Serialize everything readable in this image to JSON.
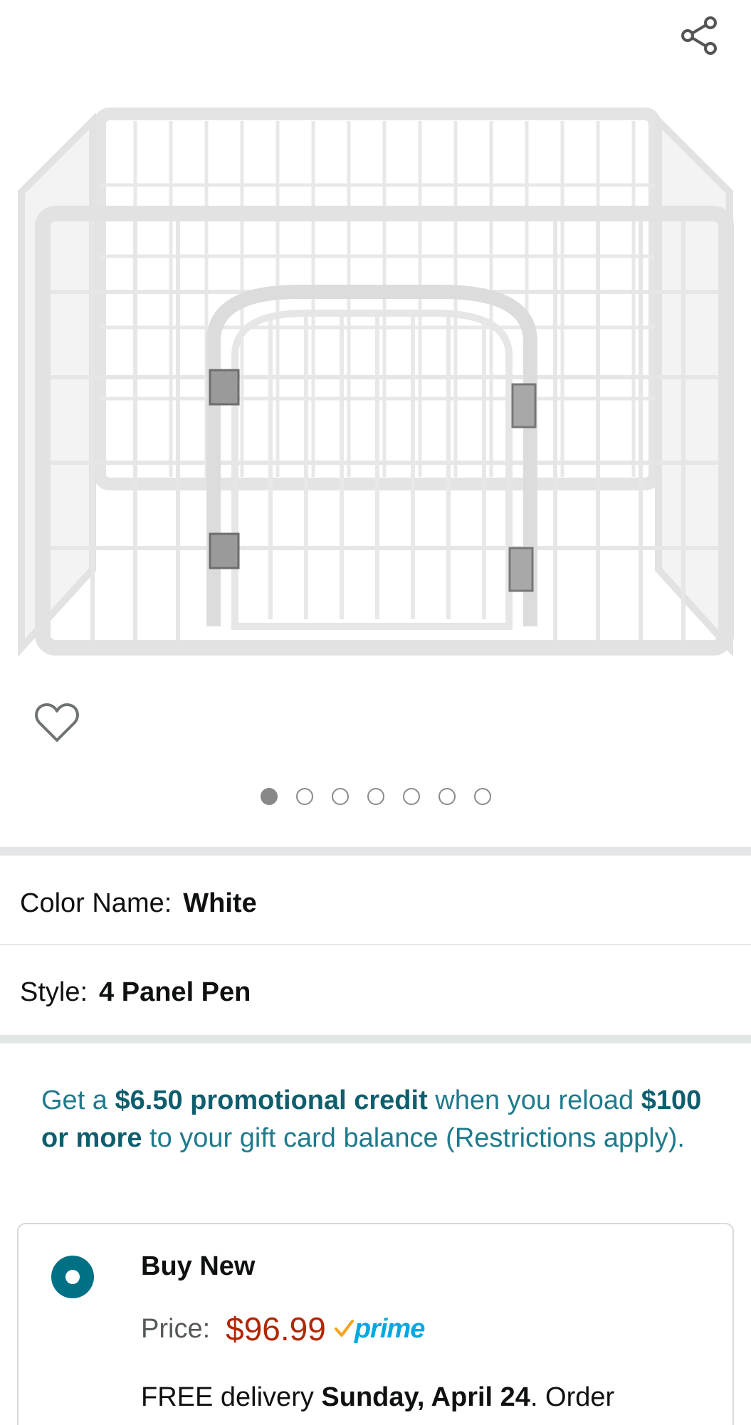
{
  "gallery": {
    "share_icon": "share-icon",
    "wishlist_icon": "heart-icon",
    "image_count": 7,
    "active_index": 0
  },
  "variations": {
    "color": {
      "label": "Color Name:",
      "value": "White"
    },
    "style": {
      "label": "Style:",
      "value": "4 Panel Pen"
    }
  },
  "promo": {
    "p1": "Get a ",
    "b1": "$6.50 promotional credit",
    "p2": " when you reload ",
    "b2": "$100 or more",
    "p3": " to your gift card balance (Restrictions apply)."
  },
  "buy_box": {
    "title": "Buy New",
    "price_label": "Price:",
    "price": "$96.99",
    "prime_label": "prime",
    "delivery_prefix": "FREE delivery ",
    "delivery_date": "Sunday, April 24",
    "delivery_suffix": ". Order"
  },
  "colors": {
    "accent": "#007185",
    "price": "#b12704",
    "promo": "#1f7a8c",
    "prime": "#00a8e1",
    "prime_check": "#f7a21b"
  }
}
